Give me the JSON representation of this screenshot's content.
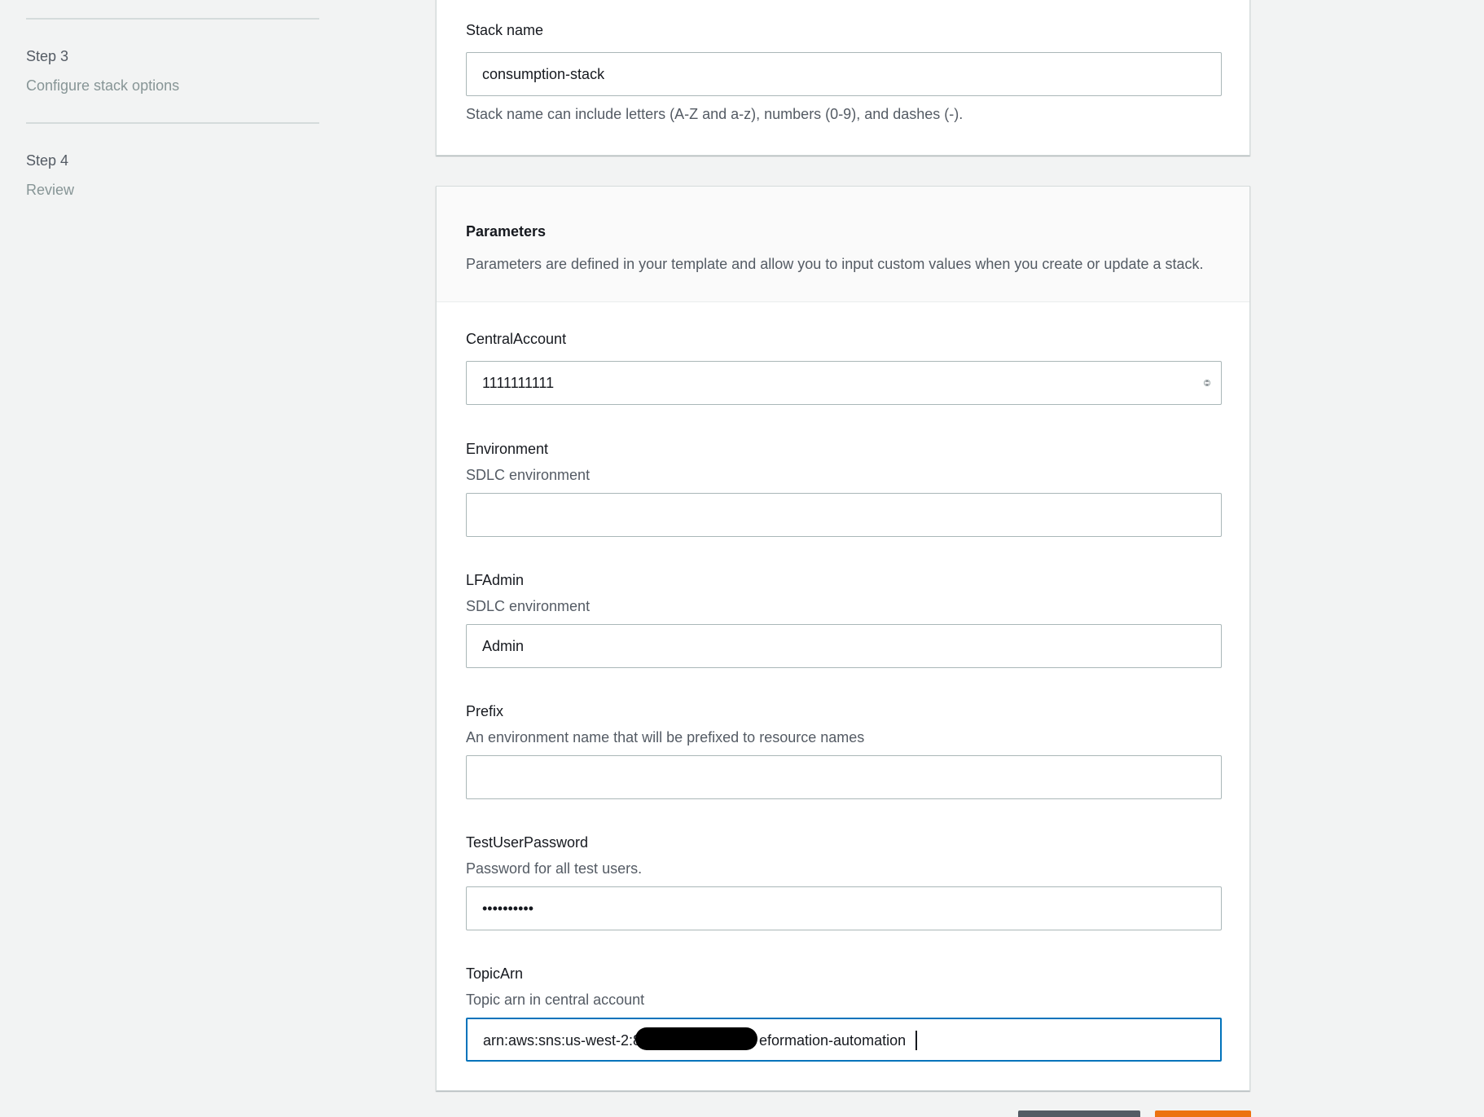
{
  "nav": {
    "steps": [
      {
        "number": "Step 3",
        "title": "Configure stack options"
      },
      {
        "number": "Step 4",
        "title": "Review"
      }
    ]
  },
  "stack": {
    "label": "Stack name",
    "value": "consumption-stack",
    "hint": "Stack name can include letters (A-Z and a-z), numbers (0-9), and dashes (-)."
  },
  "parameters": {
    "title": "Parameters",
    "description": "Parameters are defined in your template and allow you to input custom values when you create or update a stack.",
    "fields": {
      "central_account": {
        "label": "CentralAccount",
        "value": "1111111111"
      },
      "environment": {
        "label": "Environment",
        "description": "SDLC environment",
        "value": ""
      },
      "lf_admin": {
        "label": "LFAdmin",
        "description": "SDLC environment",
        "value": "Admin"
      },
      "prefix": {
        "label": "Prefix",
        "description": "An environment name that will be prefixed to resource names",
        "value": ""
      },
      "test_user_password": {
        "label": "TestUserPassword",
        "description": "Password for all test users.",
        "value": "••••••••••"
      },
      "topic_arn": {
        "label": "TopicArn",
        "description": "Topic arn in central account",
        "value_start": "arn:aws:sns:us-west-2:8",
        "value_end": "eformation-automation"
      }
    }
  },
  "icons": {
    "stepper": "number-stepper-icon"
  },
  "colors": {
    "background": "#f2f3f3",
    "focus_border": "#0073bb",
    "primary_button": "#ec7211"
  }
}
